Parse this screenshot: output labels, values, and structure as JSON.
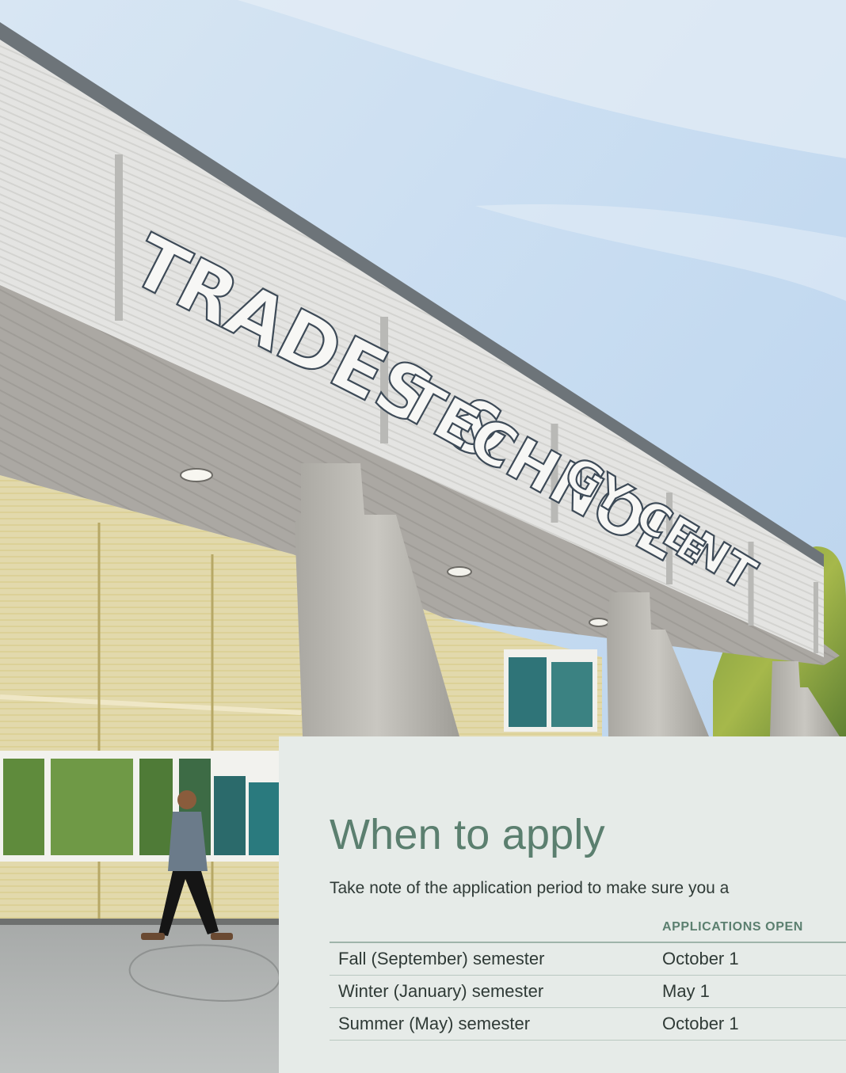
{
  "hero": {
    "building_sign": "TRADES & TECHNOLOGY CENTRE",
    "sign_parts": [
      "TRADES &",
      "TECHNOL",
      "GY CENT",
      "E"
    ]
  },
  "when_to_apply": {
    "title": "When to apply",
    "intro": "Take note of the application period to make sure you a",
    "table": {
      "headers": [
        "",
        "APPLICATIONS OPEN"
      ],
      "rows": [
        [
          "Fall (September) semester",
          "October 1"
        ],
        [
          "Winter (January) semester",
          "May 1"
        ],
        [
          "Summer (May) semester",
          "October 1"
        ]
      ]
    }
  },
  "colors": {
    "accent": "#5b7f6f",
    "card_bg": "#e6ebe8",
    "text": "#2f3a36"
  }
}
